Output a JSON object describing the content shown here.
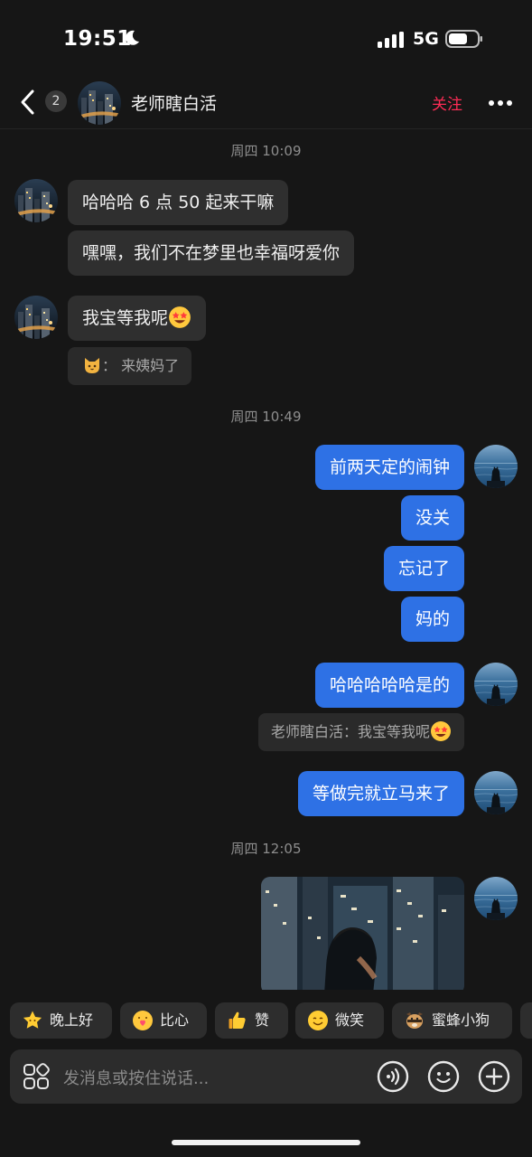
{
  "status_bar": {
    "time": "19:51",
    "network": "5G"
  },
  "header": {
    "unread_count": "2",
    "contact_name": "老师瞎白活",
    "follow_label": "关注"
  },
  "colors": {
    "background": "#161616",
    "incoming_bubble": "#2f2f2f",
    "outgoing_bubble": "#2e71e5",
    "follow": "#fe2c55"
  },
  "messages": {
    "ts1": "周四 10:09",
    "m1": "哈哈哈 6 点 50 起来干嘛",
    "m2": "嘿嘿，我们不在梦里也幸福呀爱你",
    "m3": "我宝等我呢",
    "m3_reply": "： 来姨妈了",
    "ts2": "周四 10:49",
    "m4": "前两天定的闹钟",
    "m5": "没关",
    "m6": "忘记了",
    "m7": "妈的",
    "m8": "哈哈哈哈哈是的",
    "m8_quote": "老师瞎白活：我宝等我呢",
    "m9": "等做完就立马来了",
    "ts3": "周四 12:05"
  },
  "quick_replies": [
    "晚上好",
    "比心",
    "赞",
    "微笑",
    "蜜蜂小狗"
  ],
  "input": {
    "placeholder": "发消息或按住说话..."
  },
  "icons": [
    "back-icon",
    "more-icon",
    "apps-icon",
    "voice-icon",
    "emoji-icon",
    "plus-icon",
    "star-eyes-emoji"
  ]
}
